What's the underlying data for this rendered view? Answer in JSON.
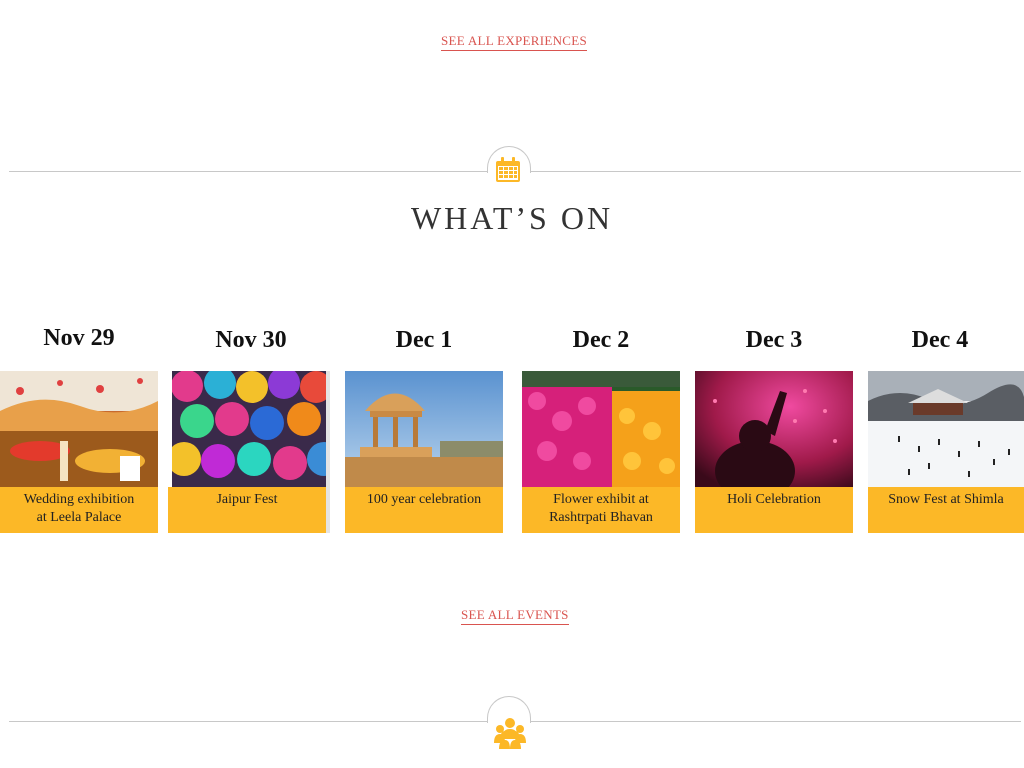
{
  "links": {
    "see_all_experiences": "SEE ALL EXPERIENCES",
    "see_all_events": "SEE ALL EVENTS"
  },
  "section": {
    "title": "WHAT’S ON",
    "icon": "calendar-icon",
    "next_icon": "people-group-icon"
  },
  "colors": {
    "accent": "#fcb827",
    "link": "#d9544f",
    "divider": "#c8c8c8"
  },
  "events": [
    {
      "date": "Nov 29",
      "caption_line1": "Wedding  exhibition",
      "caption_line2": "at Leela Palace",
      "image": "wedding-venue-image"
    },
    {
      "date": "Nov 30",
      "caption_line1": "Jaipur Fest",
      "caption_line2": "",
      "image": "colorful-umbrellas-image"
    },
    {
      "date": "Dec 1",
      "caption_line1": "100 year celebration",
      "caption_line2": "",
      "image": "sandstone-chhatri-image"
    },
    {
      "date": "Dec 2",
      "caption_line1": "Flower exhibit at",
      "caption_line2": "Rashtrpati Bhavan",
      "image": "flower-garlands-image"
    },
    {
      "date": "Dec 3",
      "caption_line1": "Holi Celebration",
      "caption_line2": "",
      "image": "holi-powder-image"
    },
    {
      "date": "Dec 4",
      "caption_line1": "Snow Fest at Shimla",
      "caption_line2": "",
      "image": "snowy-town-image"
    }
  ]
}
